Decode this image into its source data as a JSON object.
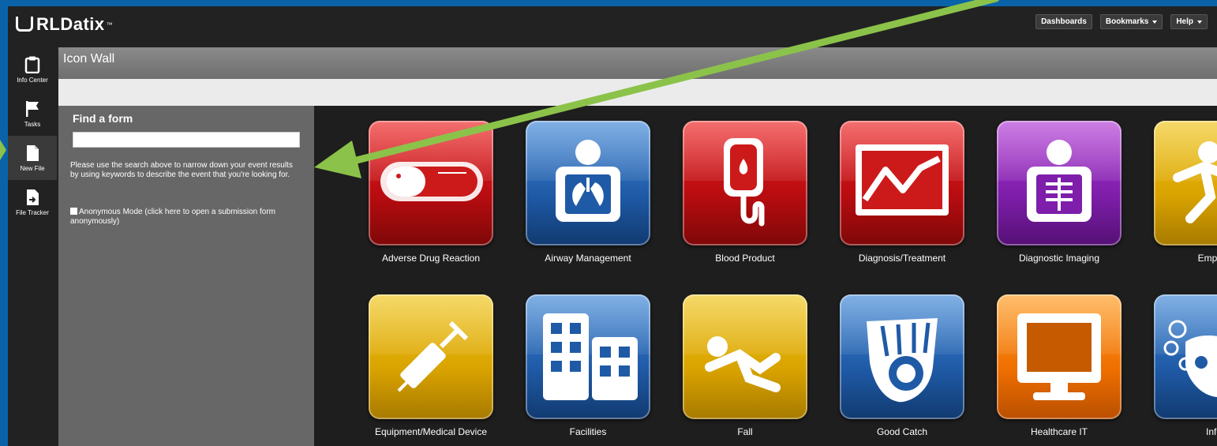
{
  "app": {
    "logo_text": "RLDatix",
    "trademark": "™"
  },
  "topnav": [
    {
      "label": "Dashboards",
      "dropdown": false
    },
    {
      "label": "Bookmarks",
      "dropdown": true
    },
    {
      "label": "Help",
      "dropdown": true
    }
  ],
  "sidenav": [
    {
      "label": "Info Center",
      "icon": "clipboard-icon",
      "active": false
    },
    {
      "label": "Tasks",
      "icon": "flag-icon",
      "active": false
    },
    {
      "label": "New File",
      "icon": "file-icon",
      "active": true
    },
    {
      "label": "File Tracker",
      "icon": "file-arrow-icon",
      "active": false
    }
  ],
  "page": {
    "title": "Icon Wall"
  },
  "find_form": {
    "heading": "Find a form",
    "search_value": "",
    "help_text": "Please use the search above to narrow down your event results by using keywords to describe the event that you're looking for.",
    "anonymous_label": "Anonymous Mode (click here to open a submission form anonymously)"
  },
  "icon_wall": [
    {
      "label": "Adverse Drug Reaction",
      "color": "red",
      "icon": "pill-icon"
    },
    {
      "label": "Airway Management",
      "color": "blue",
      "icon": "lungs-xray-icon"
    },
    {
      "label": "Blood Product",
      "color": "red",
      "icon": "blood-bag-icon"
    },
    {
      "label": "Diagnosis/Treatment",
      "color": "red",
      "icon": "chart-monitor-icon"
    },
    {
      "label": "Diagnostic Imaging",
      "color": "purple",
      "icon": "xray-person-icon"
    },
    {
      "label": "Employe",
      "color": "yellow",
      "icon": "running-person-icon"
    },
    {
      "label": "Equipment/Medical Device",
      "color": "yellow",
      "icon": "syringe-icon"
    },
    {
      "label": "Facilities",
      "color": "blue",
      "icon": "buildings-icon"
    },
    {
      "label": "Fall",
      "color": "yellow",
      "icon": "falling-person-icon"
    },
    {
      "label": "Good Catch",
      "color": "blue",
      "icon": "baseball-glove-icon"
    },
    {
      "label": "Healthcare IT",
      "color": "orange",
      "icon": "computer-monitor-icon"
    },
    {
      "label": "Infec",
      "color": "blue",
      "icon": "washing-hands-icon"
    }
  ]
}
